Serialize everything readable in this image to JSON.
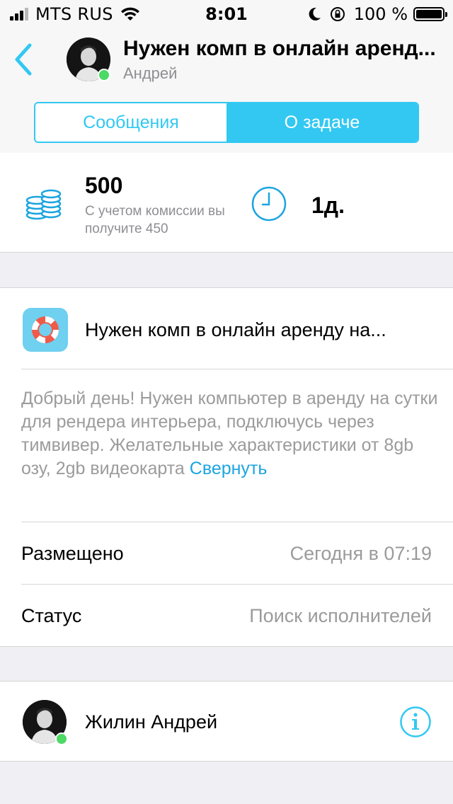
{
  "status_bar": {
    "carrier": "MTS RUS",
    "time": "8:01",
    "battery": "100 %"
  },
  "nav": {
    "title": "Нужен комп в онлайн аренд...",
    "subtitle": "Андрей",
    "tabs": [
      {
        "label": "Сообщения",
        "active": false
      },
      {
        "label": "О задаче",
        "active": true
      }
    ],
    "accent_color": "#32C8F2"
  },
  "price": {
    "value": "500",
    "note": "С учетом комиссии вы получите 450",
    "duration": "1д."
  },
  "task": {
    "title": "Нужен комп в онлайн аренду на...",
    "description": "Добрый день! Нужен компьютер в аренду на сутки для рендера интерьера, подключусь через тимвивер. Желательные характеристики от 8gb озу, 2gb видеокарта ",
    "collapse_link": "Свернуть",
    "posted_label": "Размещено",
    "posted_value": "Сегодня в 07:19",
    "status_label": "Статус",
    "status_value": "Поиск исполнителей"
  },
  "author": {
    "name": "Жилин Андрей",
    "online": true
  }
}
